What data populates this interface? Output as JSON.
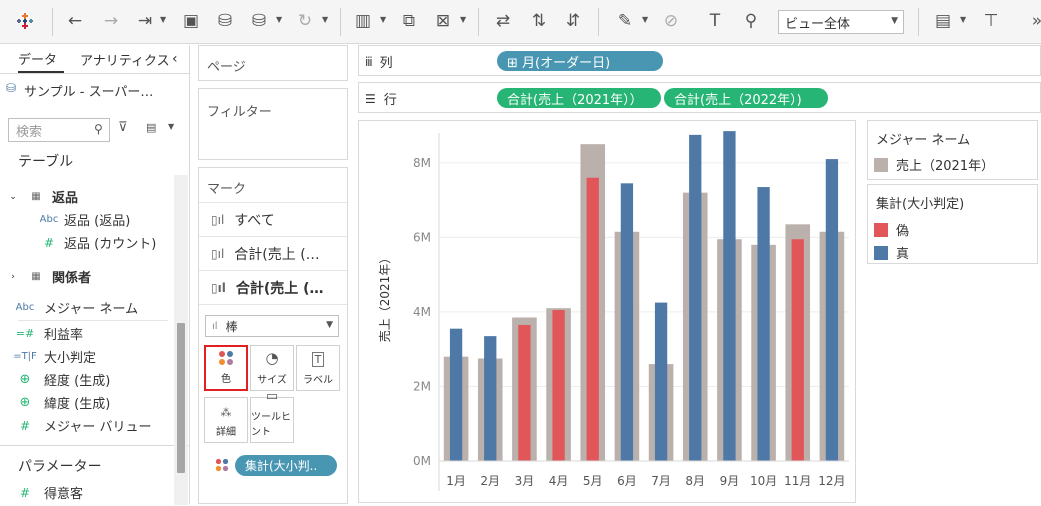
{
  "toolbar": {
    "view_select": "ビュー全体"
  },
  "left_panel": {
    "tabs": [
      "データ",
      "アナリティクス"
    ],
    "datasource": "サンプル - スーパー…",
    "search_placeholder": "検索",
    "tables_label": "テーブル",
    "fields": [
      {
        "type": "table",
        "label": "返品"
      },
      {
        "type": "abc",
        "label": "返品 (返品)"
      },
      {
        "type": "num",
        "label": "返品 (カウント)"
      },
      {
        "type": "table",
        "label": "関係者"
      },
      {
        "type": "abc",
        "label": "メジャー ネーム"
      },
      {
        "type": "calc",
        "label": "利益率"
      },
      {
        "type": "tf",
        "label": "大小判定"
      },
      {
        "type": "geo",
        "label": "経度 (生成)"
      },
      {
        "type": "geo",
        "label": "緯度 (生成)"
      },
      {
        "type": "num",
        "label": "メジャー バリュー"
      }
    ],
    "params_label": "パラメーター",
    "params": [
      {
        "type": "num",
        "label": "得意客"
      }
    ]
  },
  "cards": {
    "pages": "ページ",
    "filters": "フィルター",
    "marks": "マーク",
    "marks_rows": [
      "すべて",
      "合計(売上 (…",
      "合計(売上 (…"
    ],
    "mark_type": "棒",
    "buttons": [
      "色",
      "サイズ",
      "ラベル",
      "詳細",
      "ツールヒント"
    ],
    "color_pill": "集計(大小判.."
  },
  "shelves": {
    "columns_label": "列",
    "rows_label": "行",
    "columns_pills": [
      "⊞ 月(オーダー日)"
    ],
    "rows_pills": [
      "合計(売上（2021年））",
      "合計(売上（2022年）)"
    ]
  },
  "legends": {
    "measure_title": "メジャー ネーム",
    "measure_item": "売上（2021年）",
    "color_title": "集計(大小判定)",
    "color_items": [
      "偽",
      "真"
    ]
  },
  "colors": {
    "gray_bar": "#bab0ac",
    "red": "#e15759",
    "blue": "#4e79a7",
    "teal_pill": "#4996b2",
    "green_pill": "#26b574"
  },
  "chart_data": {
    "type": "bar",
    "categories": [
      "1月",
      "2月",
      "3月",
      "4月",
      "5月",
      "6月",
      "7月",
      "8月",
      "9月",
      "10月",
      "11月",
      "12月"
    ],
    "ylabel": "売上（2021年）",
    "yticks": [
      "0M",
      "2M",
      "4M",
      "6M",
      "8M"
    ],
    "ylim": [
      0,
      8800000
    ],
    "series": [
      {
        "name": "売上（2021年）",
        "values": [
          2800000,
          2750000,
          3850000,
          4100000,
          8500000,
          6150000,
          2600000,
          7200000,
          5950000,
          5800000,
          6350000,
          6150000
        ]
      },
      {
        "values": [
          3550000,
          3350000,
          3650000,
          4050000,
          7600000,
          7450000,
          4250000,
          8750000,
          8850000,
          7350000,
          5950000,
          8100000
        ],
        "judgment": [
          "真",
          "真",
          "偽",
          "偽",
          "偽",
          "真",
          "真",
          "真",
          "真",
          "真",
          "偽",
          "真"
        ]
      }
    ]
  }
}
